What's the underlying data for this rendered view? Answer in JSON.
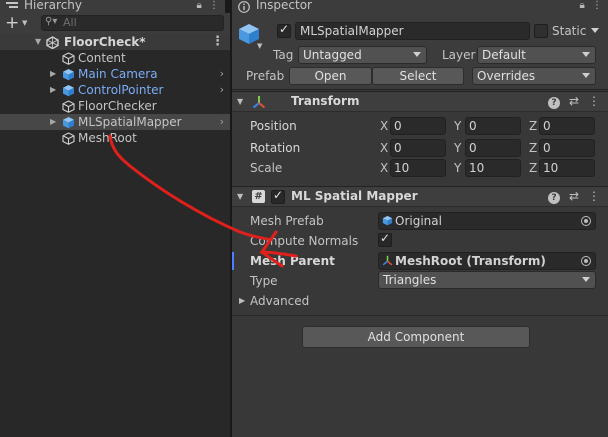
{
  "hierarchy": {
    "tab_label": "Hierarchy",
    "search_placeholder": "All",
    "scene_name": "FloorCheck*",
    "items": [
      {
        "label": "Content",
        "color": "normal"
      },
      {
        "label": "Main Camera",
        "color": "blue"
      },
      {
        "label": "ControlPointer",
        "color": "blue"
      },
      {
        "label": "FloorChecker",
        "color": "normal"
      },
      {
        "label": "MLSpatialMapper",
        "color": "normal"
      },
      {
        "label": "MeshRoot",
        "color": "normal"
      }
    ]
  },
  "inspector": {
    "tab_label": "Inspector",
    "object_name": "MLSpatialMapper",
    "static_label": "Static",
    "tag_label": "Tag",
    "tag_value": "Untagged",
    "layer_label": "Layer",
    "layer_value": "Default",
    "prefab_label": "Prefab",
    "prefab_open": "Open",
    "prefab_select": "Select",
    "prefab_overrides": "Overrides",
    "transform": {
      "title": "Transform",
      "position_label": "Position",
      "rotation_label": "Rotation",
      "scale_label": "Scale",
      "axis_x": "X",
      "axis_y": "Y",
      "axis_z": "Z",
      "position": {
        "x": "0",
        "y": "0",
        "z": "0"
      },
      "rotation": {
        "x": "0",
        "y": "0",
        "z": "0"
      },
      "scale": {
        "x": "10",
        "y": "10",
        "z": "10"
      }
    },
    "mapper": {
      "title": "ML Spatial Mapper",
      "mesh_prefab_label": "Mesh Prefab",
      "mesh_prefab_value": "Original",
      "compute_normals_label": "Compute Normals",
      "mesh_parent_label": "Mesh Parent",
      "mesh_parent_value": "MeshRoot (Transform)",
      "type_label": "Type",
      "type_value": "Triangles",
      "advanced_label": "Advanced"
    },
    "add_component_label": "Add Component"
  },
  "colors": {
    "blue_text": "#7bacf5",
    "highlight_bar": "#4c7eff",
    "annotation_red": "#e0201b"
  }
}
